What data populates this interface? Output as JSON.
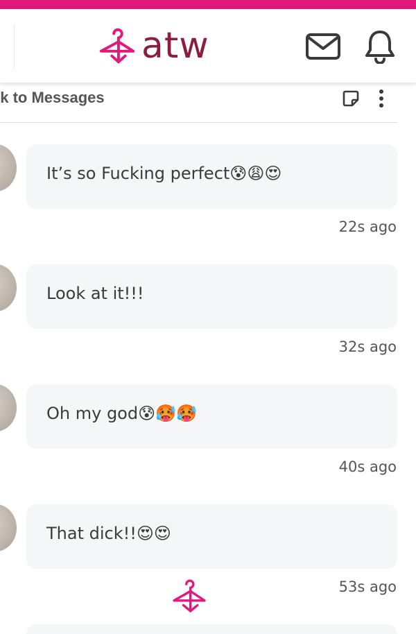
{
  "header": {
    "logo_text": "atw",
    "accent_color": "#e3187b",
    "brand_color": "#8a1e3e",
    "icons": [
      "hanger-logo-icon",
      "mail-icon",
      "bell-icon"
    ]
  },
  "subheader": {
    "back_label": "ck to Messages",
    "icons": [
      "note-icon",
      "more-vertical-icon"
    ]
  },
  "messages": [
    {
      "text": "It’s so Fucking perfect😰😩😍",
      "time": "22s ago"
    },
    {
      "text": "Look at it!!!",
      "time": "32s ago"
    },
    {
      "text": "Oh my god😰🥵🥵",
      "time": "40s ago"
    },
    {
      "text": "That dick!!😍😍",
      "time": "53s ago"
    }
  ]
}
